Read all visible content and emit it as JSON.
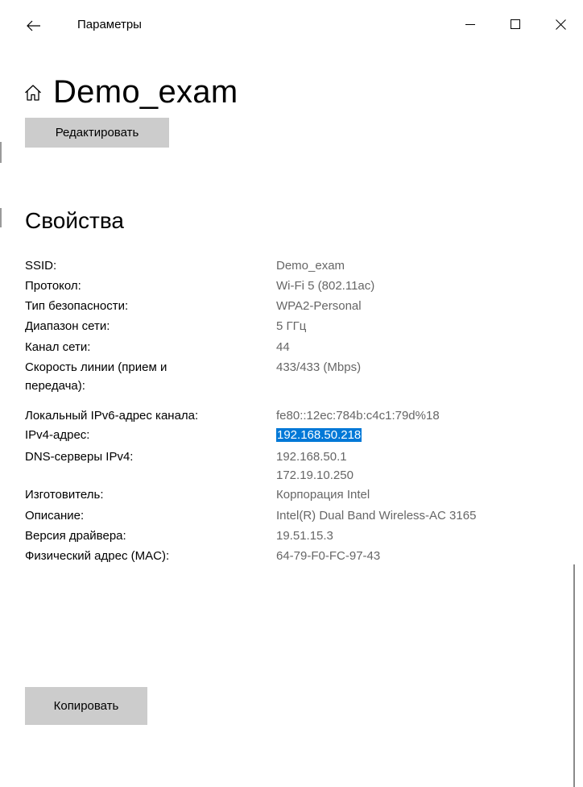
{
  "window": {
    "title": "Параметры",
    "back_icon": "arrow-left-icon",
    "minimize_icon": "minimize-icon",
    "maximize_icon": "maximize-icon",
    "close_icon": "close-icon"
  },
  "header": {
    "icon": "home-icon",
    "title": "Demo_exam",
    "edit_label": "Редактировать"
  },
  "properties": {
    "title": "Свойства",
    "rows": [
      {
        "label": "SSID:",
        "values": [
          "Demo_exam"
        ]
      },
      {
        "label": "Протокол:",
        "values": [
          "Wi-Fi 5 (802.11ac)"
        ]
      },
      {
        "label": "Тип безопасности:",
        "values": [
          "WPA2-Personal"
        ]
      },
      {
        "label": "Диапазон сети:",
        "values": [
          "5 ГГц"
        ]
      },
      {
        "label": "Канал сети:",
        "values": [
          "44"
        ]
      },
      {
        "label": "Скорость линии (прием и передача):",
        "values": [
          "433/433 (Mbps)"
        ]
      },
      {
        "label": "Локальный IPv6-адрес канала:",
        "values": [
          "fe80::12ec:784b:c4c1:79d%18"
        ]
      },
      {
        "label": "IPv4-адрес:",
        "values": [
          "192.168.50.218"
        ],
        "selected": true
      },
      {
        "label": "DNS-серверы IPv4:",
        "values": [
          "192.168.50.1",
          "172.19.10.250"
        ]
      },
      {
        "label": "Изготовитель:",
        "values": [
          "Корпорация Intel"
        ]
      },
      {
        "label": "Описание:",
        "values": [
          "Intel(R) Dual Band Wireless-AC 3165"
        ]
      },
      {
        "label": "Версия драйвера:",
        "values": [
          "19.51.15.3"
        ]
      },
      {
        "label": "Физический адрес (MAC):",
        "values": [
          "64-79-F0-FC-97-43"
        ]
      }
    ],
    "copy_label": "Копировать"
  },
  "colors": {
    "button_bg": "#cccccc",
    "value_text": "#666666",
    "selection": "#0078d7"
  }
}
